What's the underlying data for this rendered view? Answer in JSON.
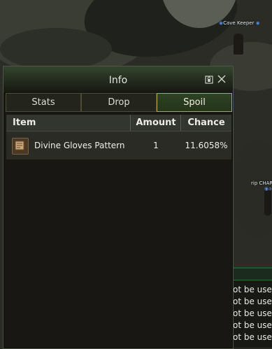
{
  "world": {
    "npc_name": "Cave Keeper",
    "player_name": "rip CHARLI",
    "clan_mark": "◉a"
  },
  "chat": {
    "lines": [
      "ot be used",
      "ot be used",
      "ot be used",
      "ot be used",
      "ot be used"
    ]
  },
  "info_window": {
    "title": "Info",
    "tabs": [
      {
        "label": "Stats",
        "active": false
      },
      {
        "label": "Drop",
        "active": false
      },
      {
        "label": "Spoil",
        "active": true
      }
    ],
    "columns": {
      "item": "Item",
      "amount": "Amount",
      "chance": "Chance"
    },
    "rows": [
      {
        "icon": "recipe-scroll-icon",
        "name": "Divine Gloves Pattern",
        "amount": "1",
        "chance": "11.6058%"
      }
    ]
  },
  "colors": {
    "active_tab_border": "#b7a14a",
    "title_bar": "#34452d",
    "npc_marker": "#5b8fe0"
  }
}
